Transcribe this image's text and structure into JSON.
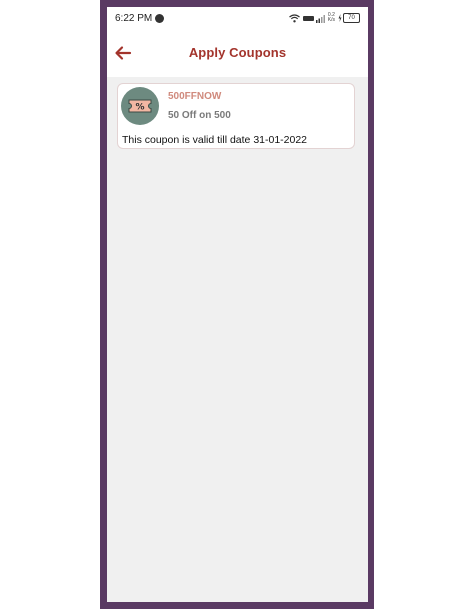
{
  "status_bar": {
    "time": "6:22 PM",
    "network_speed_top": "0.2",
    "network_speed_bottom": "K/s",
    "battery_level": "70"
  },
  "header": {
    "title": "Apply Coupons"
  },
  "coupons": [
    {
      "code": "500FFNOW",
      "description": "50 Off on 500",
      "validity": "This coupon is valid till date 31-01-2022",
      "icon": "coupon-percent-icon"
    }
  ],
  "colors": {
    "accent": "#a3342c",
    "coupon_code": "#d08a7d",
    "frame": "#5a3a63",
    "background": "#f0f0f0"
  }
}
